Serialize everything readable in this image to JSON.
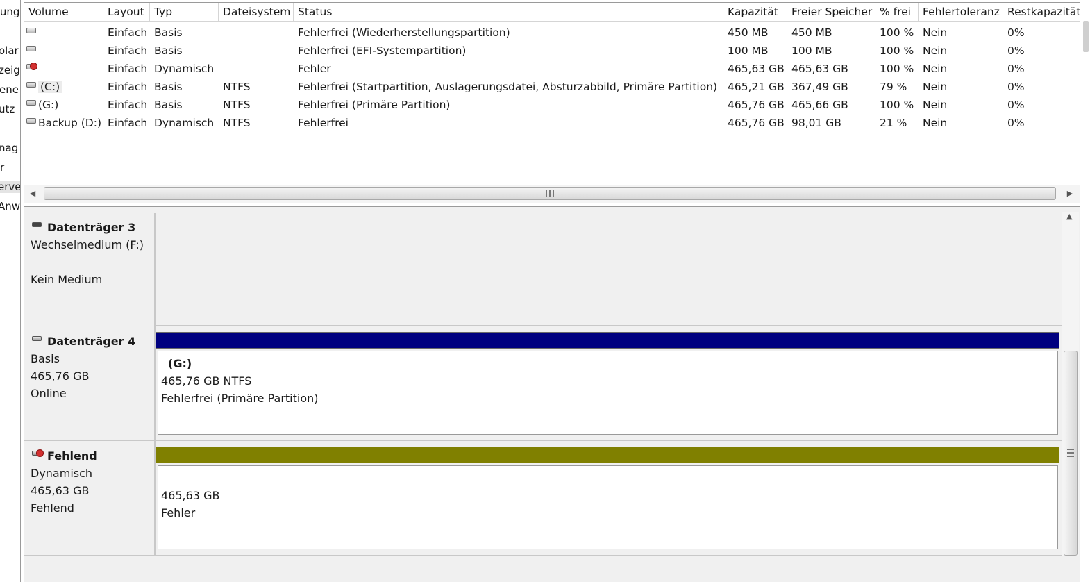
{
  "nav": {
    "items": [
      "tung",
      "olar",
      "zeig",
      "ene",
      "utz",
      "nag",
      "r",
      "erve",
      "Anw"
    ]
  },
  "columns": [
    "Volume",
    "Layout",
    "Typ",
    "Dateisystem",
    "Status",
    "Kapazität",
    "Freier Speicher",
    "% frei",
    "Fehlertoleranz",
    "Restkapazität"
  ],
  "volumes": [
    {
      "icon": "volume-icon",
      "name": "",
      "layout": "Einfach",
      "type": "Basis",
      "fs": "",
      "status": "Fehlerfrei (Wiederherstellungspartition)",
      "capacity": "450 MB",
      "free": "450 MB",
      "pct": "100 %",
      "fault": "Nein",
      "overhead": "0%"
    },
    {
      "icon": "volume-icon",
      "name": "",
      "layout": "Einfach",
      "type": "Basis",
      "fs": "",
      "status": "Fehlerfrei (EFI-Systempartition)",
      "capacity": "100 MB",
      "free": "100 MB",
      "pct": "100 %",
      "fault": "Nein",
      "overhead": "0%"
    },
    {
      "icon": "volume-error-icon",
      "name": "",
      "layout": "Einfach",
      "type": "Dynamisch",
      "fs": "",
      "status": "Fehler",
      "capacity": "465,63 GB",
      "free": "465,63 GB",
      "pct": "100 %",
      "fault": "Nein",
      "overhead": "0%"
    },
    {
      "icon": "volume-icon",
      "name": "(C:)",
      "layout": "Einfach",
      "type": "Basis",
      "fs": "NTFS",
      "status": "Fehlerfrei (Startpartition, Auslagerungsdatei, Absturzabbild, Primäre Partition)",
      "capacity": "465,21 GB",
      "free": "367,49 GB",
      "pct": "79 %",
      "fault": "Nein",
      "overhead": "0%"
    },
    {
      "icon": "volume-icon",
      "name": "(G:)",
      "layout": "Einfach",
      "type": "Basis",
      "fs": "NTFS",
      "status": "Fehlerfrei (Primäre Partition)",
      "capacity": "465,76 GB",
      "free": "465,66 GB",
      "pct": "100 %",
      "fault": "Nein",
      "overhead": "0%"
    },
    {
      "icon": "volume-icon",
      "name": "Backup (D:)",
      "layout": "Einfach",
      "type": "Dynamisch",
      "fs": "NTFS",
      "status": "Fehlerfrei",
      "capacity": "465,76 GB",
      "free": "98,01 GB",
      "pct": "21 %",
      "fault": "Nein",
      "overhead": "0%"
    }
  ],
  "scrollbar": {
    "left_arrow": "◀",
    "right_arrow": "▶",
    "up_arrow": "▲"
  },
  "disks": [
    {
      "title": "Datenträger 3",
      "lines": [
        "Wechselmedium (F:)",
        "",
        "Kein Medium"
      ],
      "icon": "removable-disk-icon"
    },
    {
      "title": "Datenträger 4",
      "lines": [
        "Basis",
        "465,76 GB",
        "Online"
      ],
      "icon": "disk-icon",
      "partition": {
        "bar_color": "#000080",
        "name": "(G:)",
        "lines": [
          "465,76 GB NTFS",
          "Fehlerfrei (Primäre Partition)"
        ]
      }
    },
    {
      "title": "Fehlend",
      "lines": [
        "Dynamisch",
        "465,63 GB",
        "Fehlend"
      ],
      "icon": "disk-error-icon",
      "partition": {
        "bar_color": "#808000",
        "name": "",
        "lines": [
          "465,63 GB",
          "Fehler"
        ]
      }
    }
  ]
}
